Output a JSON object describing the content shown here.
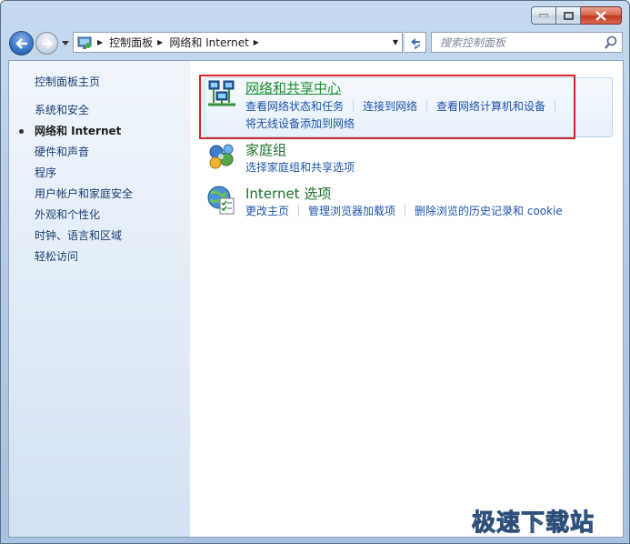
{
  "window": {
    "caption_buttons": [
      "minimize",
      "maximize",
      "close"
    ]
  },
  "nav": {
    "breadcrumb": [
      "控制面板",
      "网络和 Internet"
    ]
  },
  "search": {
    "placeholder": "搜索控制面板"
  },
  "sidebar": {
    "home": "控制面板主页",
    "items": [
      {
        "label": "系统和安全",
        "current": false
      },
      {
        "label": "网络和 Internet",
        "current": true
      },
      {
        "label": "硬件和声音",
        "current": false
      },
      {
        "label": "程序",
        "current": false
      },
      {
        "label": "用户帐户和家庭安全",
        "current": false
      },
      {
        "label": "外观和个性化",
        "current": false
      },
      {
        "label": "时钟、语言和区域",
        "current": false
      },
      {
        "label": "轻松访问",
        "current": false
      }
    ]
  },
  "categories": [
    {
      "title": "网络和共享中心",
      "icon": "network-sharing-icon",
      "links": [
        "查看网络状态和任务",
        "连接到网络",
        "查看网络计算机和设备",
        "将无线设备添加到网络"
      ]
    },
    {
      "title": "家庭组",
      "icon": "homegroup-icon",
      "links": [
        "选择家庭组和共享选项"
      ]
    },
    {
      "title": "Internet 选项",
      "icon": "internet-options-icon",
      "links": [
        "更改主页",
        "管理浏览器加载项",
        "删除浏览的历史记录和 cookie"
      ]
    }
  ],
  "watermark": "极速下载站",
  "colors": {
    "highlight_border": "#d9262a",
    "link": "#1d54a8",
    "category_title": "#1c6f2a"
  }
}
